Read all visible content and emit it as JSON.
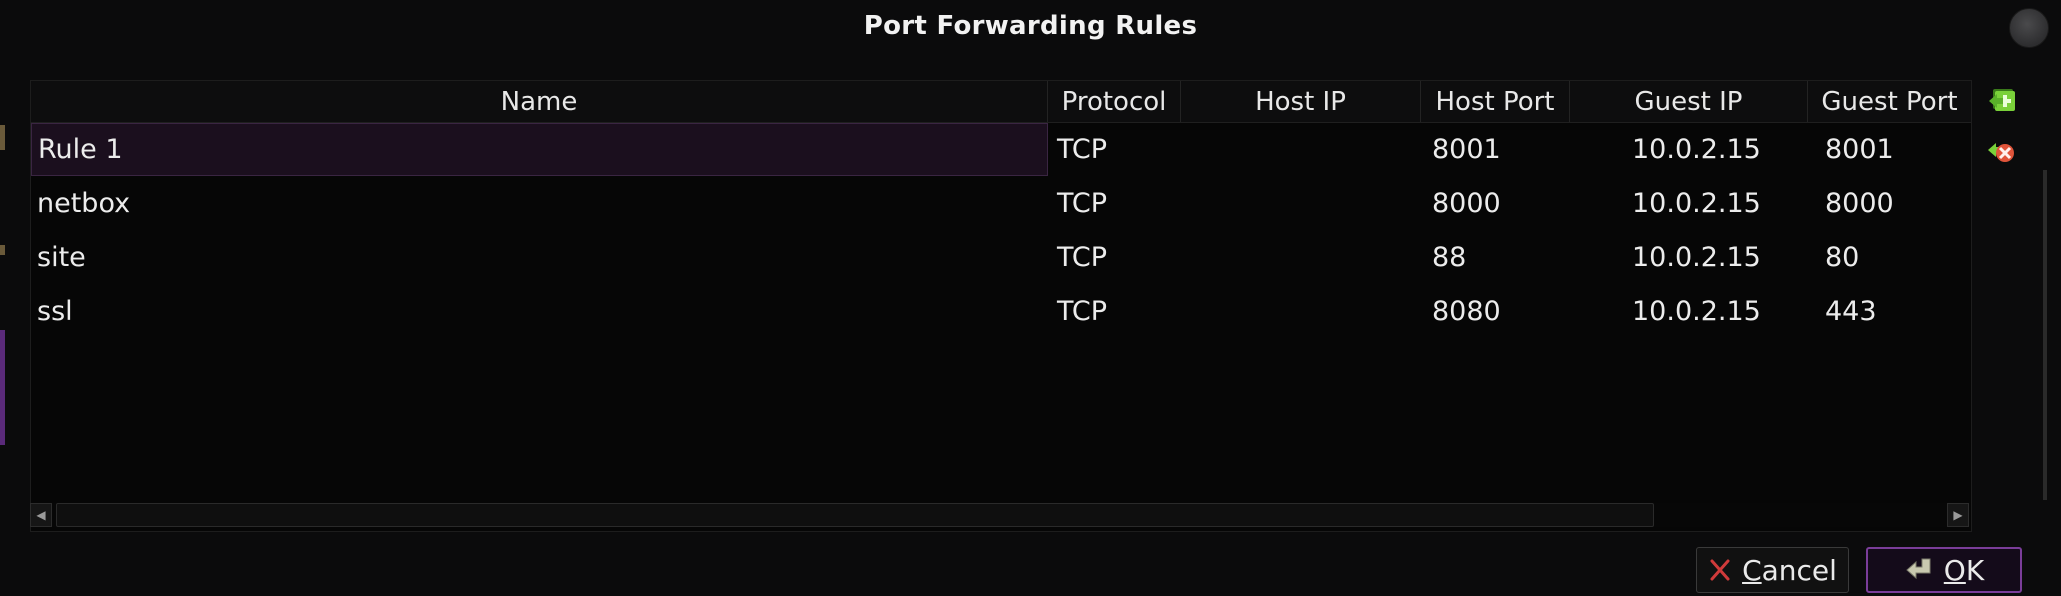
{
  "window": {
    "title": "Port Forwarding Rules"
  },
  "table": {
    "columns": [
      "Name",
      "Protocol",
      "Host IP",
      "Host Port",
      "Guest IP",
      "Guest Port"
    ],
    "rows": [
      {
        "name": "Rule 1",
        "protocol": "TCP",
        "host_ip": "",
        "host_port": "8001",
        "guest_ip": "10.0.2.15",
        "guest_port": "8001"
      },
      {
        "name": "netbox",
        "protocol": "TCP",
        "host_ip": "",
        "host_port": "8000",
        "guest_ip": "10.0.2.15",
        "guest_port": "8000"
      },
      {
        "name": "site",
        "protocol": "TCP",
        "host_ip": "",
        "host_port": "88",
        "guest_ip": "10.0.2.15",
        "guest_port": "80"
      },
      {
        "name": "ssl",
        "protocol": "TCP",
        "host_ip": "",
        "host_port": "8080",
        "guest_ip": "10.0.2.15",
        "guest_port": "443"
      }
    ],
    "selected_row": 0
  },
  "side_actions": {
    "add_icon": "add-rule-icon",
    "remove_icon": "remove-rule-icon"
  },
  "buttons": {
    "cancel_first": "C",
    "cancel_rest": "ancel",
    "ok_first": "O",
    "ok_rest": "K"
  },
  "colors": {
    "accent": "#7a3d99",
    "add": "#7ad13a",
    "remove": "#e0543a"
  }
}
